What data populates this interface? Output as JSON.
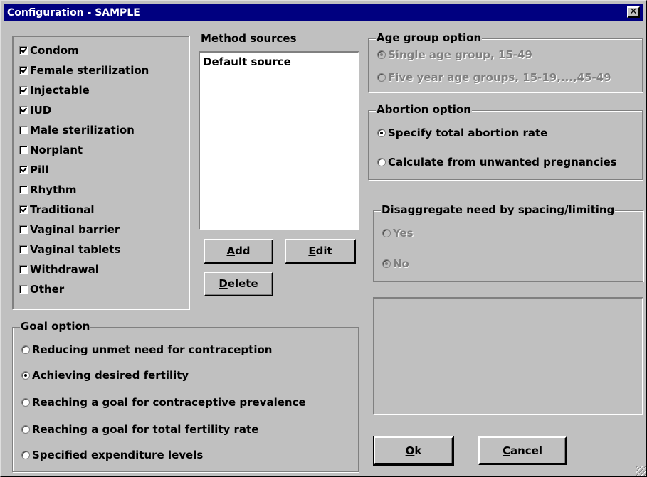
{
  "window": {
    "title": "Configuration - SAMPLE",
    "close_glyph": "✕"
  },
  "methods": {
    "items": [
      {
        "label": "Condom",
        "checked": true
      },
      {
        "label": "Female sterilization",
        "checked": true
      },
      {
        "label": "Injectable",
        "checked": true
      },
      {
        "label": "IUD",
        "checked": true
      },
      {
        "label": "Male sterilization",
        "checked": false
      },
      {
        "label": "Norplant",
        "checked": false
      },
      {
        "label": "Pill",
        "checked": true
      },
      {
        "label": "Rhythm",
        "checked": false
      },
      {
        "label": "Traditional",
        "checked": true
      },
      {
        "label": "Vaginal barrier",
        "checked": false
      },
      {
        "label": "Vaginal tablets",
        "checked": false
      },
      {
        "label": "Withdrawal",
        "checked": false
      },
      {
        "label": "Other",
        "checked": false
      }
    ]
  },
  "sources": {
    "heading": "Method sources",
    "items": [
      "Default source"
    ],
    "add_pre": "",
    "add_key": "A",
    "add_post": "dd",
    "edit_pre": "",
    "edit_key": "E",
    "edit_post": "dit",
    "delete_pre": "",
    "delete_key": "D",
    "delete_post": "elete"
  },
  "age_group": {
    "legend": "Age group option",
    "options": [
      {
        "label": "Single age group, 15-49",
        "selected": true
      },
      {
        "label": "Five year age groups, 15-19,...,45-49",
        "selected": false
      }
    ]
  },
  "abortion": {
    "legend": "Abortion option",
    "options": [
      {
        "label": "Specify total abortion rate",
        "selected": true
      },
      {
        "label": "Calculate from unwanted pregnancies",
        "selected": false
      }
    ]
  },
  "disaggregate": {
    "legend": "Disaggregate need by spacing/limiting",
    "options": [
      {
        "label": "Yes",
        "selected": false
      },
      {
        "label": "No",
        "selected": true
      }
    ]
  },
  "goal": {
    "legend": "Goal option",
    "options": [
      {
        "label": "Reducing unmet need for contraception",
        "selected": false
      },
      {
        "label": "Achieving desired fertility",
        "selected": true
      },
      {
        "label": "Reaching a goal for contraceptive prevalence",
        "selected": false
      },
      {
        "label": "Reaching a goal for total fertility rate",
        "selected": false
      },
      {
        "label": "Specified expenditure levels",
        "selected": false
      }
    ]
  },
  "footer": {
    "ok_pre": "",
    "ok_key": "O",
    "ok_post": "k",
    "cancel_pre": "",
    "cancel_key": "C",
    "cancel_post": "ancel"
  },
  "colors": {
    "face": "#c0c0c0",
    "title": "#000080",
    "shadow": "#808080",
    "highlight": "#ffffff"
  }
}
